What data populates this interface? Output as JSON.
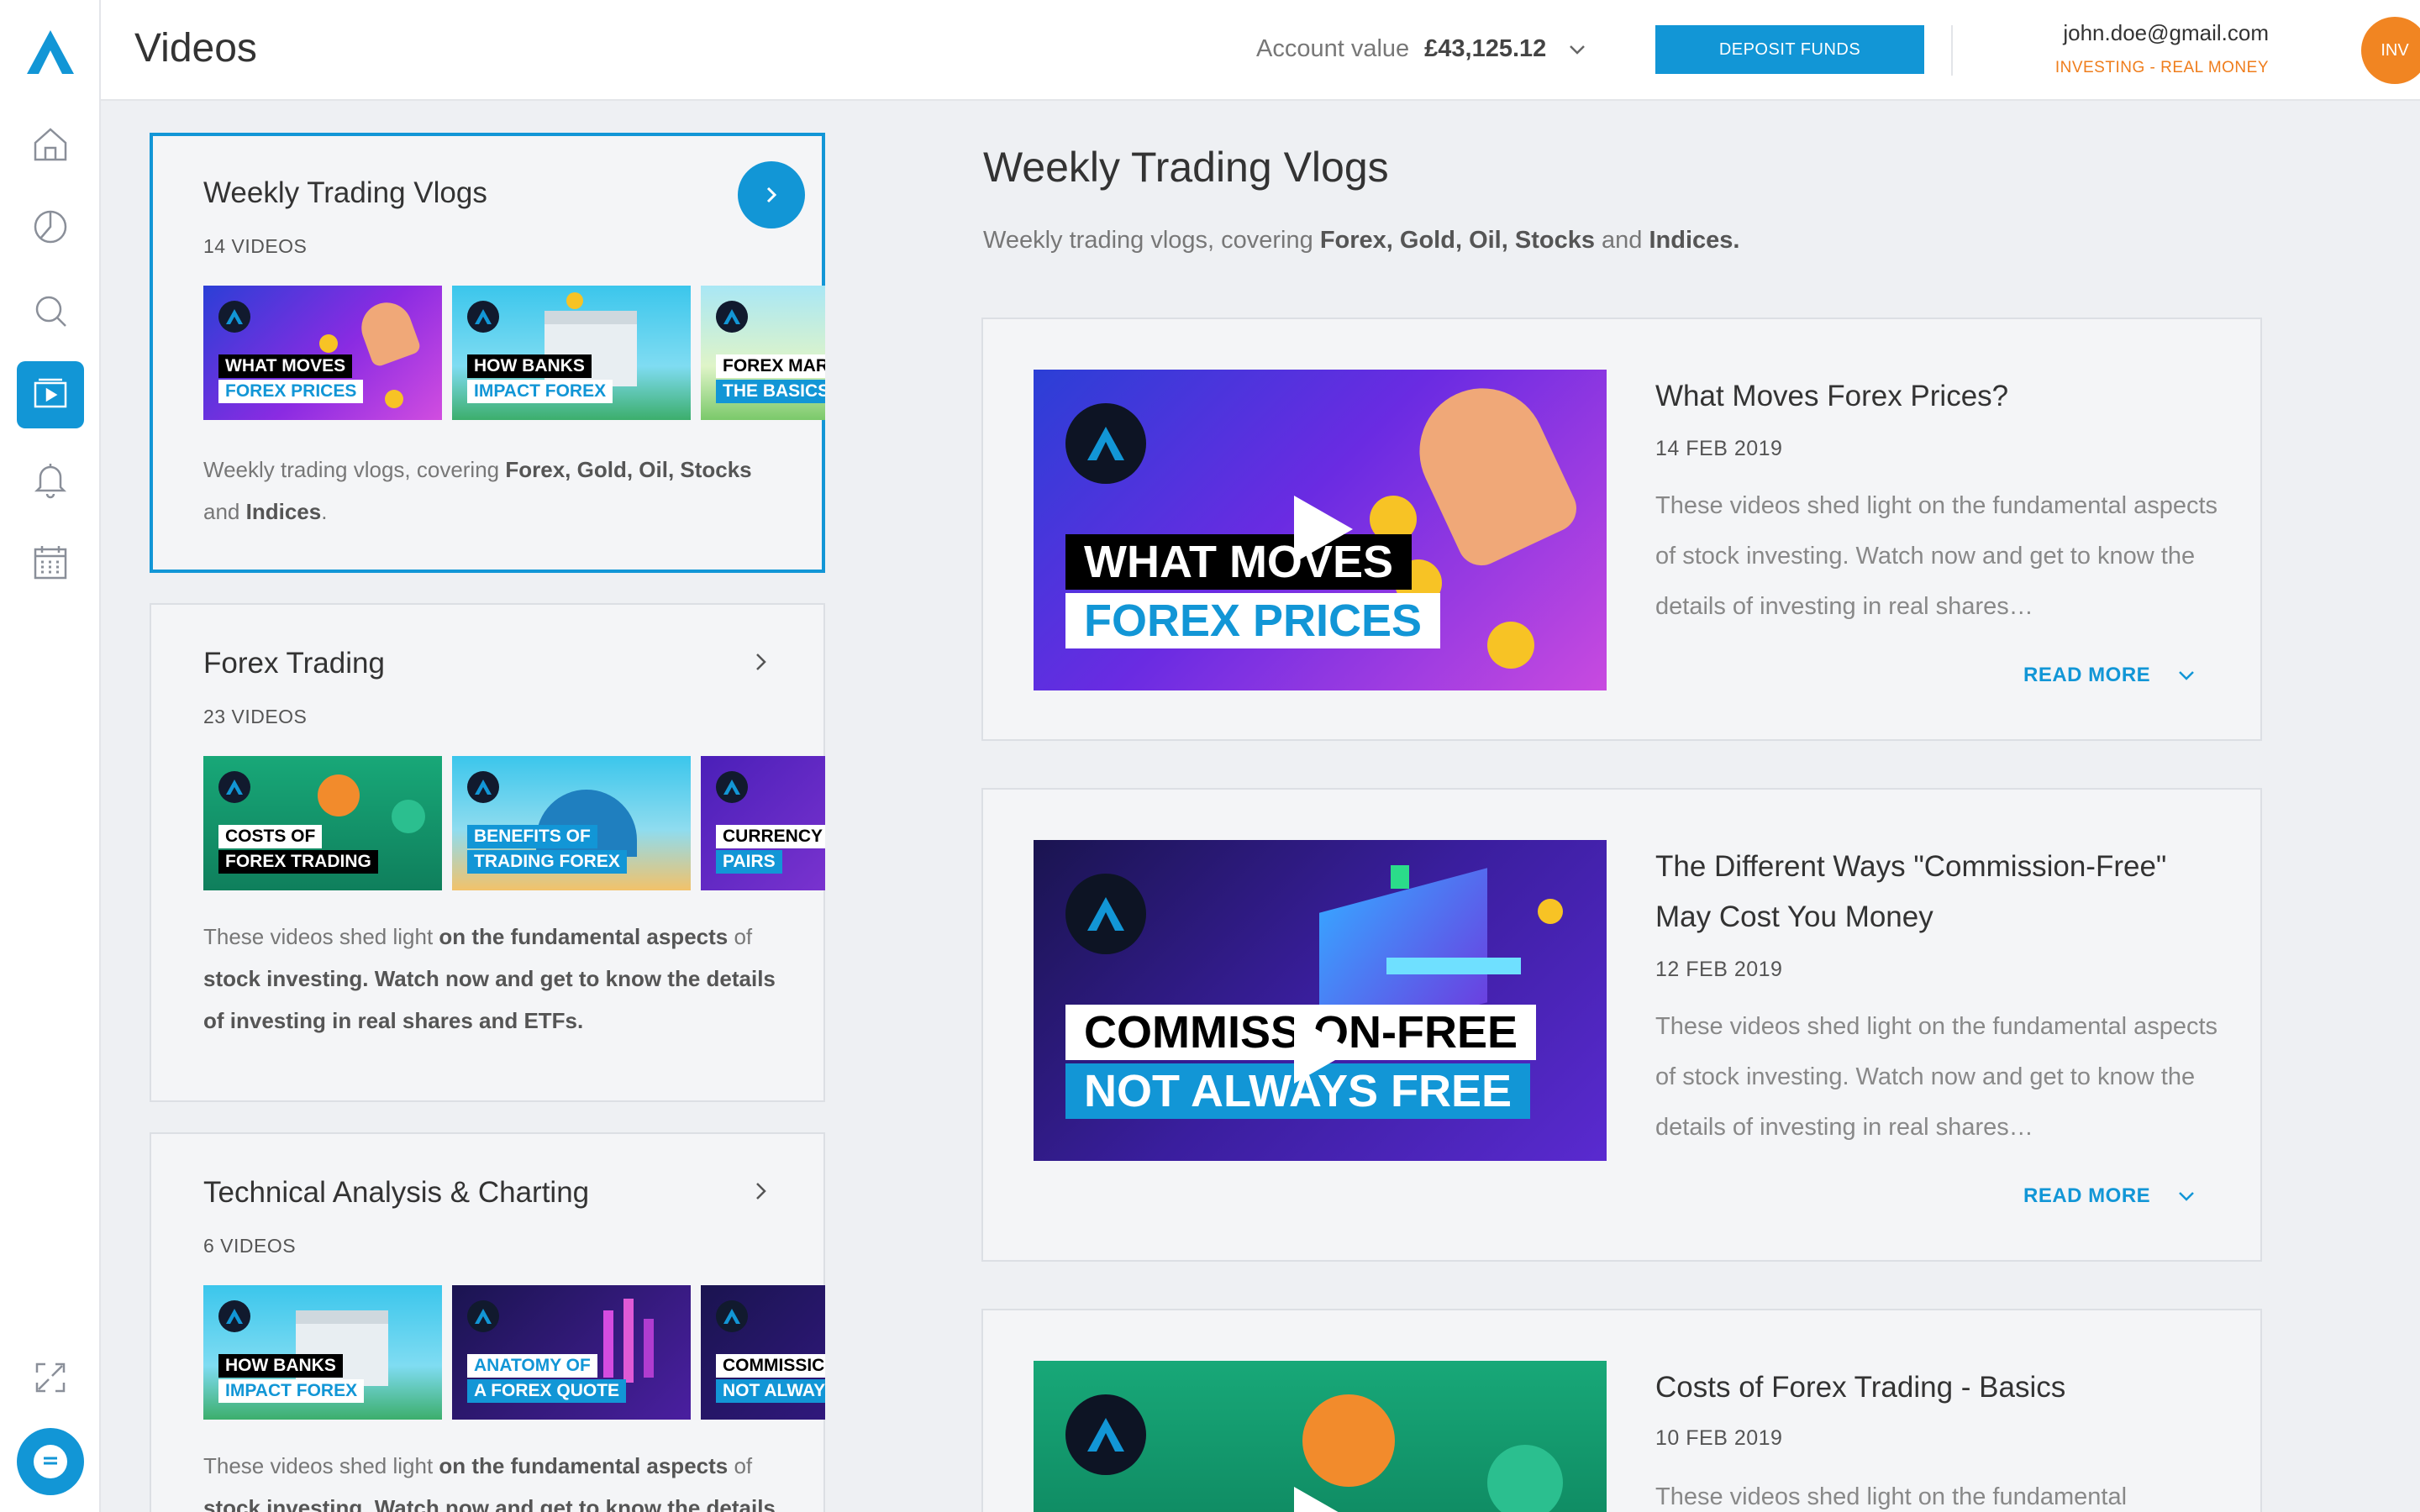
{
  "header": {
    "page_title": "Videos",
    "account_label": "Account value",
    "account_value": "£43,125.12",
    "deposit_label": "DEPOSIT FUNDS",
    "user_email": "john.doe@gmail.com",
    "user_mode": "INVESTING - REAL MONEY",
    "avatar_initials": "INV"
  },
  "sidebar": {
    "items": [
      {
        "icon": "home-icon"
      },
      {
        "icon": "portfolio-pie-icon"
      },
      {
        "icon": "search-icon"
      },
      {
        "icon": "video-icon",
        "active": true
      },
      {
        "icon": "bell-icon"
      },
      {
        "icon": "calendar-icon"
      }
    ]
  },
  "playlists": [
    {
      "title": "Weekly Trading Vlogs",
      "count": "14 VIDEOS",
      "desc_parts": [
        "Weekly trading vlogs, covering ",
        "Forex, Gold, Oil, Stocks",
        " and ",
        "Indices",
        "."
      ],
      "thumbs": [
        {
          "l1": "WHAT MOVES",
          "l2": "FOREX PRICES"
        },
        {
          "l1": "HOW BANKS",
          "l2": "IMPACT FOREX"
        },
        {
          "l1": "FOREX MAR",
          "l2": "THE BASICS"
        }
      ]
    },
    {
      "title": "Forex Trading",
      "count": "23 VIDEOS",
      "desc_parts": [
        "These videos shed light ",
        "on the fundamental aspects",
        " of ",
        "stock investing. Watch now and get to know the details of investing in real shares and ETFs.",
        ""
      ],
      "thumbs": [
        {
          "l1": "COSTS OF",
          "l2": "FOREX TRADING"
        },
        {
          "l1": "BENEFITS OF",
          "l2": "TRADING FOREX"
        },
        {
          "l1": "CURRENCY",
          "l2": "PAIRS"
        }
      ]
    },
    {
      "title": "Technical Analysis & Charting",
      "count": "6 VIDEOS",
      "desc_parts": [
        "These videos shed light ",
        "on the fundamental aspects",
        " of ",
        "stock investing. Watch now and get to know the details",
        ""
      ],
      "thumbs": [
        {
          "l1": "HOW BANKS",
          "l2": "IMPACT FOREX"
        },
        {
          "l1": "ANATOMY OF",
          "l2": "A FOREX QUOTE"
        },
        {
          "l1": "COMMISSIC",
          "l2": "NOT ALWAY"
        }
      ]
    }
  ],
  "detail": {
    "title": "Weekly Trading Vlogs",
    "desc_parts": [
      "Weekly trading vlogs, covering ",
      "Forex, Gold, Oil, Stocks",
      " and ",
      "Indices."
    ],
    "read_more": "READ MORE",
    "videos": [
      {
        "title": "What Moves Forex Prices?",
        "date": "14 FEB 2019",
        "desc": "These videos shed light on the fundamental aspects of stock investing. Watch now and get to know the details of investing in real shares…",
        "l1": "WHAT MOVES",
        "l2": "FOREX PRICES"
      },
      {
        "title": "The Different Ways \"Commission-Free\" May Cost You Money",
        "date": "12 FEB 2019",
        "desc": "These videos shed light on the fundamental aspects of stock investing. Watch now and get to know the details of investing in real shares…",
        "l1": "COMMISS ON-FREE",
        "l2": "NOT ALWAYS FREE"
      },
      {
        "title": "Costs of Forex Trading - Basics",
        "date": "10 FEB 2019",
        "desc": "These videos shed light on the fundamental"
      }
    ]
  },
  "colors": {
    "accent": "#1296d6",
    "orange": "#f18522",
    "background": "#eef0f3"
  }
}
